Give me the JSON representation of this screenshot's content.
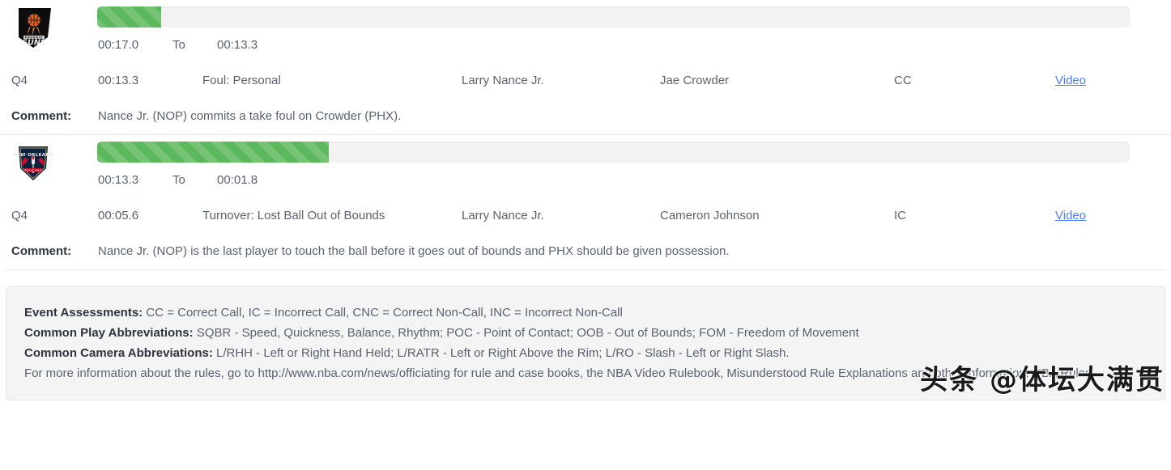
{
  "plays": [
    {
      "team_logo": "phoenix-suns-logo",
      "team_name": "Phoenix Suns",
      "progress_percent": 6.2,
      "period_start": "00:17.0",
      "to_label": "To",
      "period_end": "00:13.3",
      "period": "Q4",
      "clock": "00:13.3",
      "call_type": "Foul: Personal",
      "committing_player": "Larry Nance Jr.",
      "disadvantaged_player": "Jae Crowder",
      "assessment": "CC",
      "video_label": "Video",
      "comment_label": "Comment:",
      "comment": "Nance Jr. (NOP) commits a take foul on Crowder (PHX)."
    },
    {
      "team_logo": "new-orleans-pelicans-logo",
      "team_name": "New Orleans Pelicans",
      "progress_percent": 22.4,
      "period_start": "00:13.3",
      "to_label": "To",
      "period_end": "00:01.8",
      "period": "Q4",
      "clock": "00:05.6",
      "call_type": "Turnover: Lost Ball Out of Bounds",
      "committing_player": "Larry Nance Jr.",
      "disadvantaged_player": "Cameron Johnson",
      "assessment": "IC",
      "video_label": "Video",
      "comment_label": "Comment:",
      "comment": "Nance Jr. (NOP) is the last player to touch the ball before it goes out of bounds and PHX should be given possession."
    }
  ],
  "legend": {
    "event_assessments_key": "Event Assessments:",
    "event_assessments_value": " CC = Correct Call, IC = Incorrect Call, CNC = Correct Non-Call, INC = Incorrect Non-Call",
    "play_abbreviations_key": "Common Play Abbreviations:",
    "play_abbreviations_value": " SQBR - Speed, Quickness, Balance, Rhythm; POC - Point of Contact; OOB - Out of Bounds; FOM - Freedom of Movement",
    "camera_abbreviations_key": "Common Camera Abbreviations:",
    "camera_abbreviations_value": " L/RHH - Left or Right Hand Held; L/RATR - Left or Right Above the Rim; L/RO - Slash - Left or Right Slash.",
    "more_info": "For more information about the rules, go to http://www.nba.com/news/officiating for rule and case books, the NBA Video Rulebook, Misunderstood Rule Explanations and other information. NBA Rules"
  },
  "watermark": "头条 @体坛大满贯",
  "colors": {
    "progress_fill": "#5cb85c",
    "progress_track": "#f2f2f2",
    "link": "#4a7dfd",
    "text": "#5a6170",
    "heading": "#2e3440",
    "legend_bg": "#f4f4f5"
  }
}
